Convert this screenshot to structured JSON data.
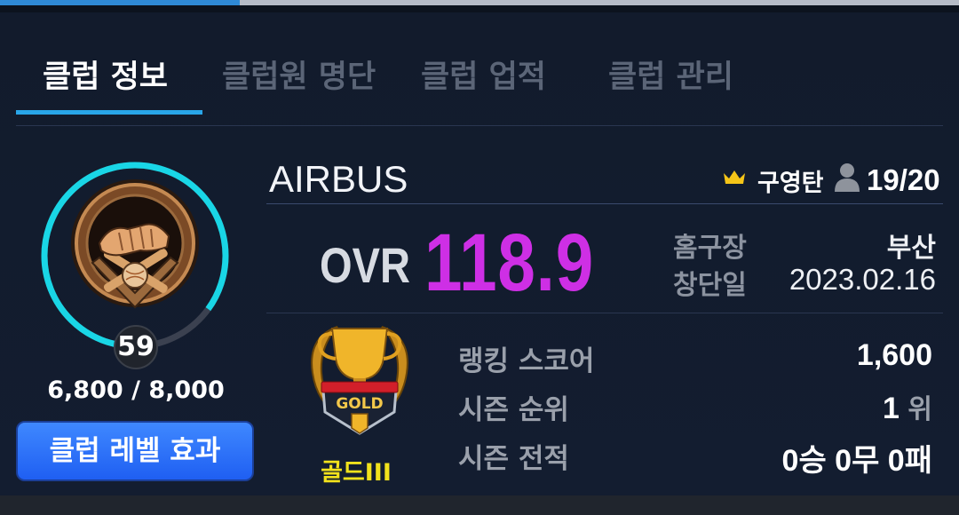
{
  "tabs": [
    {
      "label": "클럽 정보",
      "active": true
    },
    {
      "label": "클럽원 명단",
      "active": false
    },
    {
      "label": "클럽 업적",
      "active": false
    },
    {
      "label": "클럽 관리",
      "active": false
    }
  ],
  "club": {
    "name": "AIRBUS",
    "leader": "구영탄",
    "members": "19/20",
    "ovr_label": "OVR",
    "ovr_value": "118.9",
    "home_label": "홈구장",
    "home_value": "부산",
    "founded_label": "창단일",
    "founded_value": "2023.02.16"
  },
  "level": {
    "value": "59",
    "exp_text": "6,800 / 8,000",
    "progress": 0.85,
    "button_label": "클럽 레벨 효과"
  },
  "tier": {
    "emblem_text": "GOLD",
    "label": "골드III"
  },
  "ranking": {
    "score_label": "랭킹 스코어",
    "score_value": "1,600",
    "season_rank_label": "시즌 순위",
    "season_rank_value": "1",
    "season_rank_unit": "위",
    "season_record_label": "시즌 전적",
    "season_record_value": "0승 0무 0패"
  },
  "colors": {
    "ovr": "#ce2fe5",
    "ring": "#19d6e6",
    "tab_active_underline": "#29a6e8",
    "tier": "#f2e21c",
    "button": "#2a6ff7"
  },
  "top_progress": 0.25
}
